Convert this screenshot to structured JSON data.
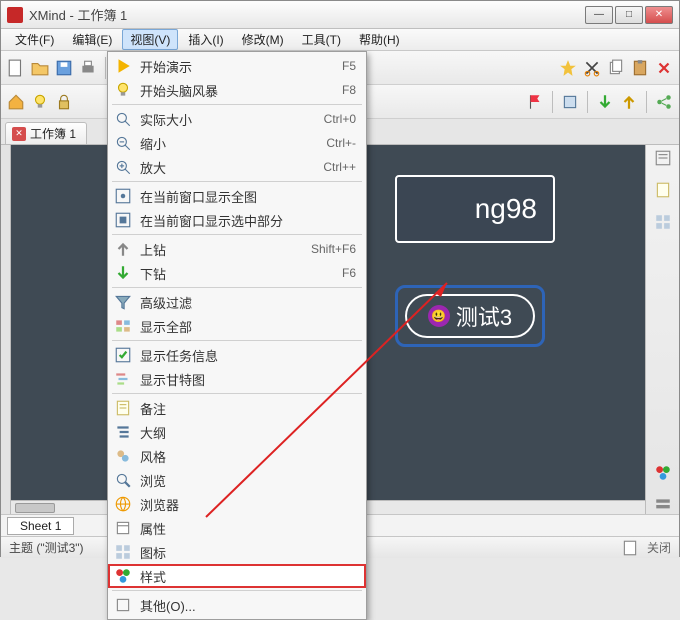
{
  "window": {
    "app_name": "XMind",
    "doc_name": "工作簿 1"
  },
  "menubar": {
    "items": [
      "文件(F)",
      "编辑(E)",
      "视图(V)",
      "插入(I)",
      "修改(M)",
      "工具(T)",
      "帮助(H)"
    ]
  },
  "doctab": {
    "label": "工作簿 1"
  },
  "canvas": {
    "node1_text": "ng98",
    "node2_text": "测试3"
  },
  "sheet": {
    "tab": "Sheet 1"
  },
  "status": {
    "left": "主题 (\"测试3\")",
    "right_label": "关闭"
  },
  "view_menu": {
    "items": [
      {
        "icon": "play",
        "label": "开始演示",
        "shortcut": "F5"
      },
      {
        "icon": "bulb",
        "label": "开始头脑风暴",
        "shortcut": "F8"
      },
      {
        "sep": true
      },
      {
        "icon": "zoom-reset",
        "label": "实际大小",
        "shortcut": "Ctrl+0"
      },
      {
        "icon": "zoom-out",
        "label": "缩小",
        "shortcut": "Ctrl+-"
      },
      {
        "icon": "zoom-in",
        "label": "放大",
        "shortcut": "Ctrl++"
      },
      {
        "sep": true
      },
      {
        "icon": "fit-all",
        "label": "在当前窗口显示全图",
        "shortcut": ""
      },
      {
        "icon": "fit-sel",
        "label": "在当前窗口显示选中部分",
        "shortcut": ""
      },
      {
        "sep": true
      },
      {
        "icon": "up",
        "label": "上钻",
        "shortcut": "Shift+F6"
      },
      {
        "icon": "down",
        "label": "下钻",
        "shortcut": "F6"
      },
      {
        "sep": true
      },
      {
        "icon": "filter",
        "label": "高级过滤",
        "shortcut": ""
      },
      {
        "icon": "show-all",
        "label": "显示全部",
        "shortcut": ""
      },
      {
        "sep": true
      },
      {
        "icon": "task",
        "label": "显示任务信息",
        "shortcut": ""
      },
      {
        "icon": "gantt",
        "label": "显示甘特图",
        "shortcut": ""
      },
      {
        "sep": true
      },
      {
        "icon": "note",
        "label": "备注",
        "shortcut": ""
      },
      {
        "icon": "outline",
        "label": "大纲",
        "shortcut": ""
      },
      {
        "icon": "style2",
        "label": "风格",
        "shortcut": ""
      },
      {
        "icon": "browse",
        "label": "浏览",
        "shortcut": ""
      },
      {
        "icon": "browser",
        "label": "浏览器",
        "shortcut": ""
      },
      {
        "icon": "props",
        "label": "属性",
        "shortcut": ""
      },
      {
        "icon": "iconset",
        "label": "图标",
        "shortcut": ""
      },
      {
        "icon": "style",
        "label": "样式",
        "shortcut": "",
        "highlight": true
      },
      {
        "sep": true
      },
      {
        "icon": "other",
        "label": "其他(O)...",
        "shortcut": ""
      }
    ]
  }
}
